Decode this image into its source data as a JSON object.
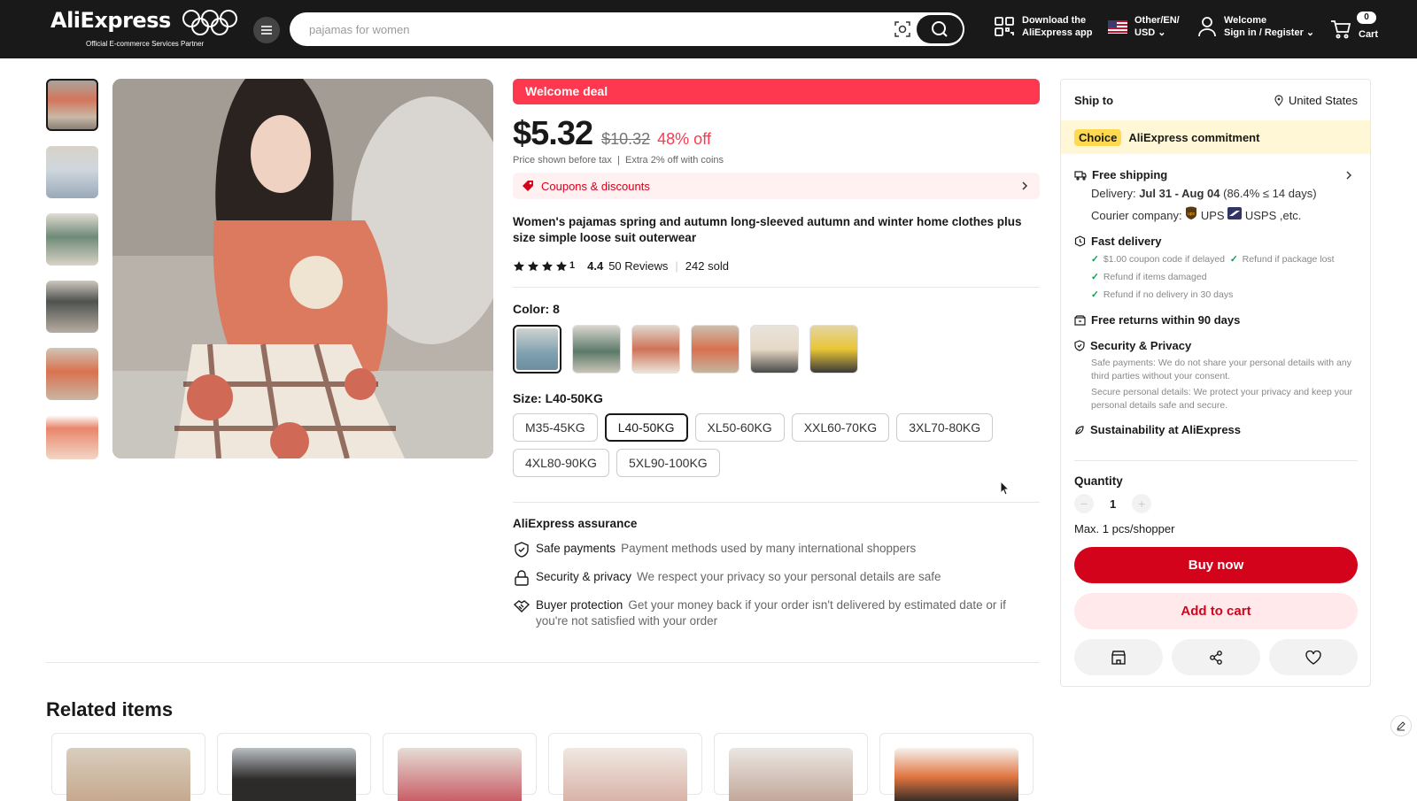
{
  "header": {
    "logo": "AliExpress",
    "logo_sub": "Official E-commerce Services Partner",
    "search_placeholder": "pajamas for women",
    "app_line1": "Download the",
    "app_line2": "AliExpress app",
    "locale_line1": "Other/EN/",
    "locale_line2": "USD",
    "account_line1": "Welcome",
    "account_line2": "Sign in / Register",
    "cart_count": "0",
    "cart_label": "Cart"
  },
  "product": {
    "welcome_deal": "Welcome deal",
    "price": "$5.32",
    "old_price": "$10.32",
    "discount": "48% off",
    "price_note": "Price shown before tax",
    "coins_note": "Extra 2% off with coins",
    "coupons": "Coupons & discounts",
    "title": "Women's pajamas spring and autumn long-sleeved autumn and winter home clothes plus size simple loose suit outerwear",
    "rating_count_label": "1",
    "rating": "4.4",
    "reviews": "50 Reviews",
    "sold": "242 sold",
    "color_label": "Color: 8",
    "size_label": "Size: L40-50KG",
    "sizes": [
      "M35-45KG",
      "L40-50KG",
      "XL50-60KG",
      "XXL60-70KG",
      "3XL70-80KG",
      "4XL80-90KG",
      "5XL90-100KG"
    ]
  },
  "assurance": {
    "title": "AliExpress assurance",
    "items": [
      {
        "key": "Safe payments",
        "value": "Payment methods used by many international shoppers"
      },
      {
        "key": "Security & privacy",
        "value": "We respect your privacy so your personal details are safe"
      },
      {
        "key": "Buyer protection",
        "value": "Get your money back if your order isn't delivered by estimated date or if you're not satisfied with your order"
      }
    ]
  },
  "panel": {
    "ship_to": "Ship to",
    "country": "United States",
    "choice_tag": "Choice",
    "choice_text": "AliExpress commitment",
    "free_shipping": "Free shipping",
    "delivery_prefix": "Delivery:",
    "delivery_dates": "Jul 31 - Aug 04",
    "delivery_stat": "(86.4% ≤ 14 days)",
    "courier_prefix": "Courier company:",
    "courier_ups": "UPS",
    "courier_usps": "USPS ,etc.",
    "fast_delivery": "Fast delivery",
    "fd_1": "$1.00 coupon code if delayed",
    "fd_2": "Refund if package lost",
    "fd_3": "Refund if items damaged",
    "fd_4": "Refund if no delivery in 30 days",
    "free_returns": "Free returns within 90 days",
    "security": "Security & Privacy",
    "sec_1": "Safe payments: We do not share your personal details with any third parties without your consent.",
    "sec_2": "Secure personal details: We protect your privacy and keep your personal details safe and secure.",
    "sustainability": "Sustainability at AliExpress",
    "quantity_label": "Quantity",
    "quantity": "1",
    "max_note": "Max. 1 pcs/shopper",
    "buy_now": "Buy now",
    "add_to_cart": "Add to cart"
  },
  "related": {
    "title": "Related items"
  },
  "colors": {
    "accent": "#fd384f",
    "buy": "#d3031c",
    "header_bg": "#191919",
    "choice_bg": "#fff7d5"
  }
}
